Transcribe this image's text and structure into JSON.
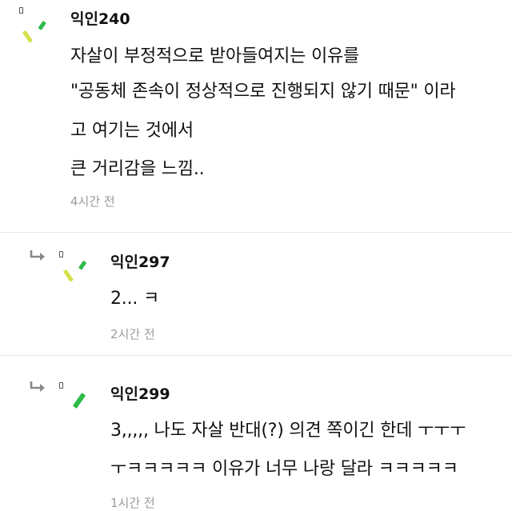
{
  "comments": [
    {
      "author": "익인240",
      "lines": [
        "자살이 부정적으로 받아들여지는 이유를",
        "\"공동체 존속이 정상적으로 진행되지 않기 때문\" 이라",
        "고 여기는 것에서",
        "큰 거리감을 느낌.."
      ],
      "time": "4시간 전",
      "is_reply": false
    },
    {
      "author": "익인297",
      "lines": [
        "2... ㅋ"
      ],
      "time": "2시간 전",
      "is_reply": true
    },
    {
      "author": "익인299",
      "lines": [
        "3,,,,, 나도 자살 반대(?) 의견 쪽이긴 한데 ㅜㅜㅜ",
        "ㅜㅋㅋㅋㅋㅋ 이유가 너무 나랑 달라 ㅋㅋㅋㅋㅋ"
      ],
      "time": "1시간 전",
      "is_reply": true
    }
  ],
  "icons": {
    "avatar": "leaf-avatar-icon",
    "reply": "reply-arrow-icon"
  },
  "colors": {
    "avatar_yellow": "#d4e04a",
    "avatar_green": "#2fba4a",
    "time_text": "#9a9a9a"
  }
}
